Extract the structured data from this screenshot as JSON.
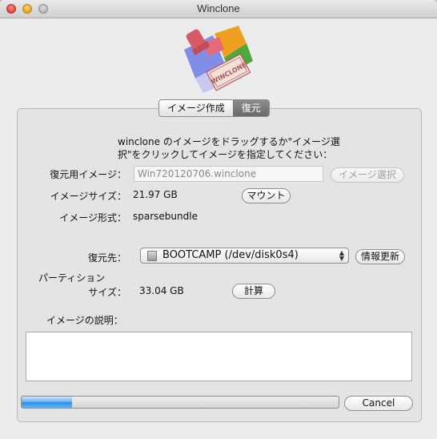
{
  "window": {
    "title": "Winclone"
  },
  "logo": {
    "stamp_text": "WINCLONE"
  },
  "tabs": [
    {
      "label": "イメージ作成",
      "selected": false
    },
    {
      "label": "復元",
      "selected": true
    }
  ],
  "instructions": {
    "line1": "winclone のイメージをドラッグするか\"イメージ選",
    "line2": "択\"をクリックしてイメージを指定してください："
  },
  "restore_image": {
    "label": "復元用イメージ：",
    "value": "Win720120706.winclone",
    "select_button": "イメージ選択"
  },
  "image_size": {
    "label": "イメージサイズ：",
    "value": "21.97 GB",
    "mount_button": "マウント"
  },
  "image_format": {
    "label": "イメージ形式：",
    "value": "sparsebundle"
  },
  "destination": {
    "label": "復元先：",
    "selected": "BOOTCAMP (/dev/disk0s4)",
    "refresh_button": "情報更新"
  },
  "partition_size": {
    "label_line1": "パーティション",
    "label_line2": "サイズ：",
    "value": "33.04 GB",
    "calc_button": "計算"
  },
  "description": {
    "label": "イメージの説明：",
    "value": ""
  },
  "progress": {
    "fraction": 0.16
  },
  "cancel_button": "Cancel"
}
